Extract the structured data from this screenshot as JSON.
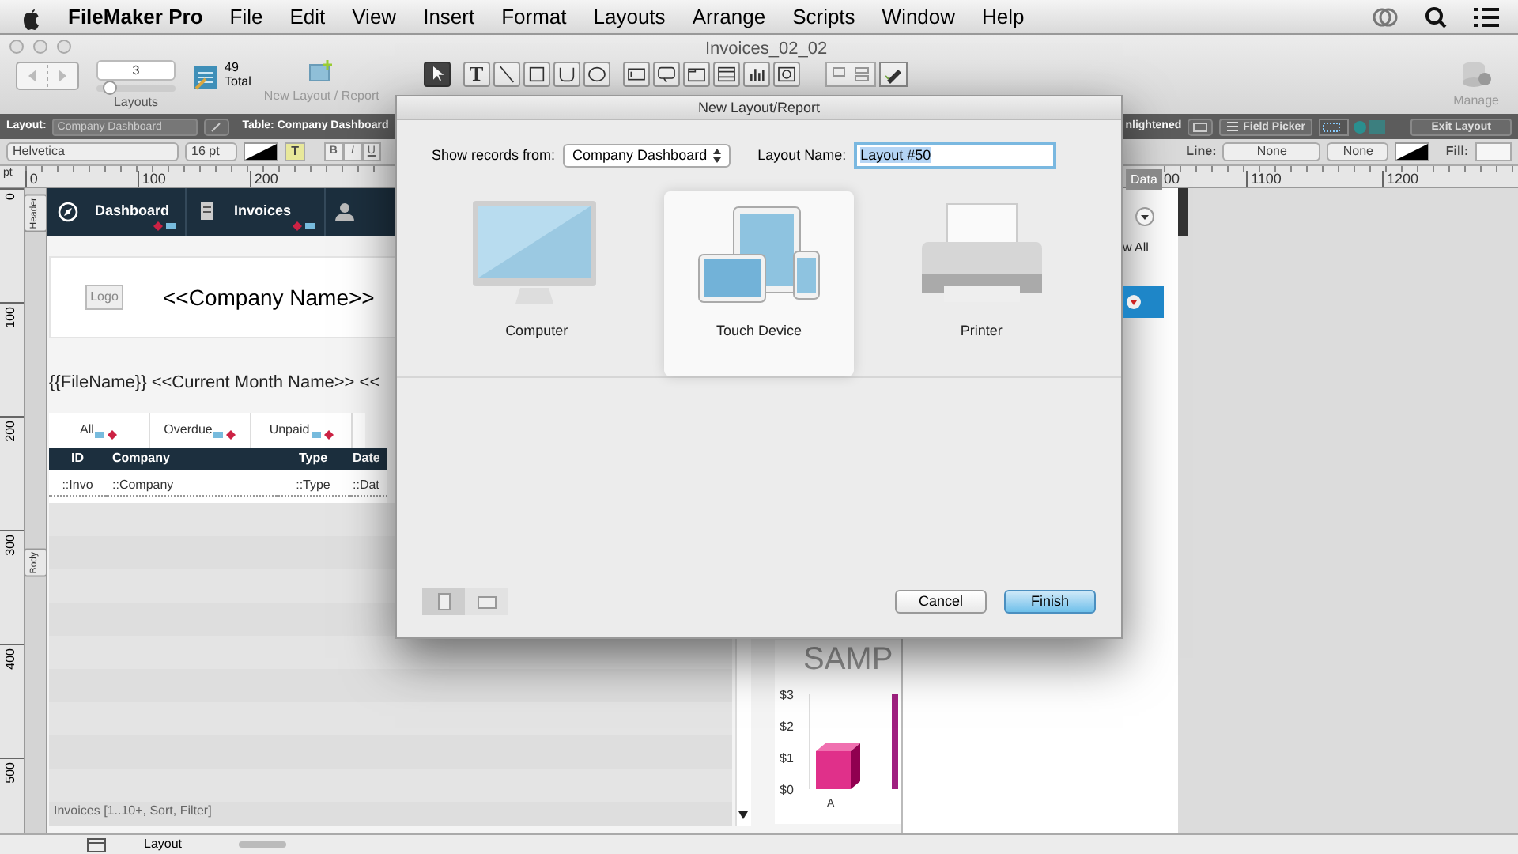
{
  "menu_bar": {
    "app": "FileMaker Pro",
    "items": [
      "File",
      "Edit",
      "View",
      "Insert",
      "Format",
      "Layouts",
      "Arrange",
      "Scripts",
      "Window",
      "Help"
    ]
  },
  "window": {
    "title": "Invoices_02_02"
  },
  "toolbar": {
    "layout_number": "3",
    "layout_slider": {
      "level": 0.1
    },
    "record_count": "49",
    "total_label": "Total",
    "layouts_label": "Layouts",
    "new_layout_label": "New Layout / Report",
    "manage_label": "Manage",
    "tools": [
      {
        "kind": "pointer",
        "selected": true
      },
      {
        "kind": "text",
        "label": "T",
        "selected": false
      },
      {
        "kind": "line",
        "selected": false
      },
      {
        "kind": "rect",
        "selected": false
      },
      {
        "kind": "rounded",
        "selected": false
      },
      {
        "kind": "oval",
        "selected": false
      },
      {
        "kind": "field",
        "selected": false
      },
      {
        "kind": "button",
        "selected": false
      },
      {
        "kind": "panel",
        "selected": false
      },
      {
        "kind": "portal",
        "selected": false
      },
      {
        "kind": "chart",
        "selected": false
      },
      {
        "kind": "web",
        "selected": false
      }
    ]
  },
  "layout_bar": {
    "layout_label": "Layout:",
    "layout_popup": "Company Dashboard",
    "table": "Table:  Company Dashboard",
    "theme": "nlightened",
    "field_picker": "Field Picker",
    "exit": "Exit Layout"
  },
  "format_bar": {
    "font": "Helvetica",
    "size": "16 pt",
    "highlight": "T",
    "styles": [
      "B",
      "I",
      "U"
    ],
    "line_label": "Line:",
    "line_width": "None",
    "line_style": "None",
    "fill_label": "Fill:"
  },
  "ruler": {
    "unit": "pt",
    "marks": [
      "0",
      "100",
      "200"
    ],
    "right_marks": [
      "00",
      "1100",
      "1200"
    ]
  },
  "vertical_ruler": {
    "marks": [
      "0",
      "100",
      "200",
      "300",
      "400",
      "500"
    ],
    "parts": [
      "Header",
      "Body"
    ]
  },
  "canvas": {
    "nav_items": [
      "Dashboard",
      "Invoices"
    ],
    "logo": "Logo",
    "company_name": "<<Company Name>>",
    "merge_line": "{{FileName}} <<Current Month Name>> <<",
    "filter_tabs": [
      "All",
      "Overdue",
      "Unpaid"
    ],
    "table": {
      "columns": [
        "ID",
        "Company",
        "Type",
        "Date"
      ],
      "row": [
        "::Invo",
        "::Company",
        "::Type",
        "::Dat"
      ]
    },
    "portal_label": "Invoices [1..10+, Sort, Filter]",
    "chart_watermark": "SAMP",
    "chart_data": {
      "type": "bar",
      "categories": [
        "A"
      ],
      "values": [
        1.2
      ],
      "ylim": [
        0,
        3
      ],
      "yticks": [
        {
          "value": 0,
          "label": "$0"
        },
        {
          "value": 1,
          "label": "$1"
        },
        {
          "value": 2,
          "label": "$2"
        },
        {
          "value": 3,
          "label": "$3"
        }
      ]
    }
  },
  "right_panel": {
    "tab": "Data",
    "show_all": "w All"
  },
  "status_bar": {
    "mode": "Layout"
  },
  "dialog": {
    "title": "New Layout/Report",
    "show_from_label": "Show records from:",
    "show_from_value": "Company Dashboard",
    "name_label": "Layout Name:",
    "name_value": "Layout #50",
    "devices": [
      {
        "kind": "computer",
        "label": "Computer",
        "selected": false
      },
      {
        "kind": "touch",
        "label": "Touch Device",
        "selected": true
      },
      {
        "kind": "printer",
        "label": "Printer",
        "selected": false
      }
    ],
    "orientation": [
      {
        "kind": "portrait",
        "selected": true
      },
      {
        "kind": "landscape",
        "selected": false
      }
    ],
    "buttons": [
      {
        "label": "Cancel",
        "default": false
      },
      {
        "label": "Finish",
        "default": true
      }
    ]
  }
}
